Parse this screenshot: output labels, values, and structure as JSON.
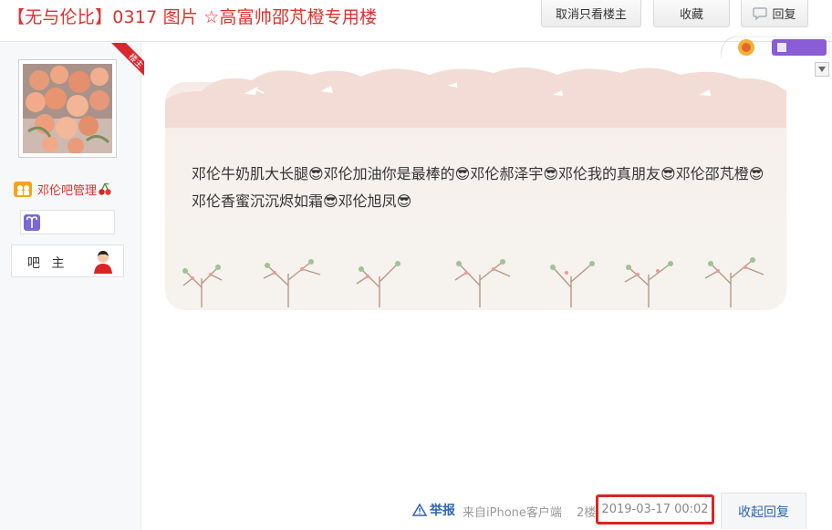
{
  "header": {
    "title": "【无与伦比】0317 图片 ☆高富帅邵芃橙专用楼",
    "cancel_label": "取消只看楼主",
    "favorite_label": "收藏",
    "reply_label": "回复"
  },
  "author": {
    "corner_label": "楼主",
    "name": "邓伦吧管理",
    "role": "吧 主",
    "zodiac_icon": "aries-icon",
    "badge_icon": "cherry-icon"
  },
  "post": {
    "content": "邓伦牛奶肌大长腿😎邓伦加油你是最棒的😎邓伦郝泽宇😎邓伦我的真朋友😎邓伦邵芃橙😎邓伦香蜜沉沉烬如霜😎邓伦旭凤😎"
  },
  "footer": {
    "report_label": "举报",
    "client": "来自iPhone客户端",
    "floor": "2楼",
    "date": "2019-03-17 00:02",
    "collapse_reply_label": "收起回复"
  },
  "colors": {
    "title_red": "#e0302c",
    "link_blue": "#2d64b3",
    "highlight_red": "#d9271f"
  }
}
